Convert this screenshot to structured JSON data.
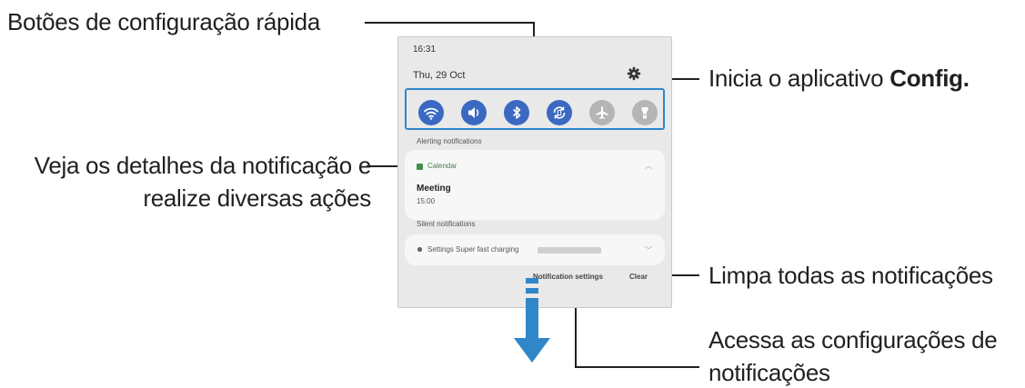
{
  "callouts": {
    "quick_settings": "Botões de configuração rápida",
    "settings_prefix": "Inicia o aplicativo ",
    "settings_bold": "Config.",
    "details_line1": "Veja os detalhes da notificação e",
    "details_line2": "realize diversas ações",
    "clear": "Limpa todas as notificações",
    "notif_settings_line1": "Acessa as configurações de",
    "notif_settings_line2": "notificações"
  },
  "panel": {
    "time": "16:31",
    "date": "Thu, 29 Oct",
    "quick_buttons": [
      {
        "icon": "wifi-icon",
        "state": "on"
      },
      {
        "icon": "sound-icon",
        "state": "on"
      },
      {
        "icon": "bluetooth-icon",
        "state": "on"
      },
      {
        "icon": "auto-rotate-icon",
        "state": "on"
      },
      {
        "icon": "airplane-icon",
        "state": "off"
      },
      {
        "icon": "flashlight-icon",
        "state": "off"
      }
    ],
    "alerting_label": "Alerting notifications",
    "calendar_app": "Calendar",
    "meeting_title": "Meeting",
    "meeting_time": "15:00",
    "silent_label": "Silent notifications",
    "silent_text": "Settings  Super fast charging",
    "notification_settings": "Notification settings",
    "clear": "Clear"
  },
  "colors": {
    "accent": "#2f86c8",
    "button_on": "#3b69c2",
    "button_off": "#b5b5b5",
    "swipe_arrow": "#2f86c8"
  }
}
